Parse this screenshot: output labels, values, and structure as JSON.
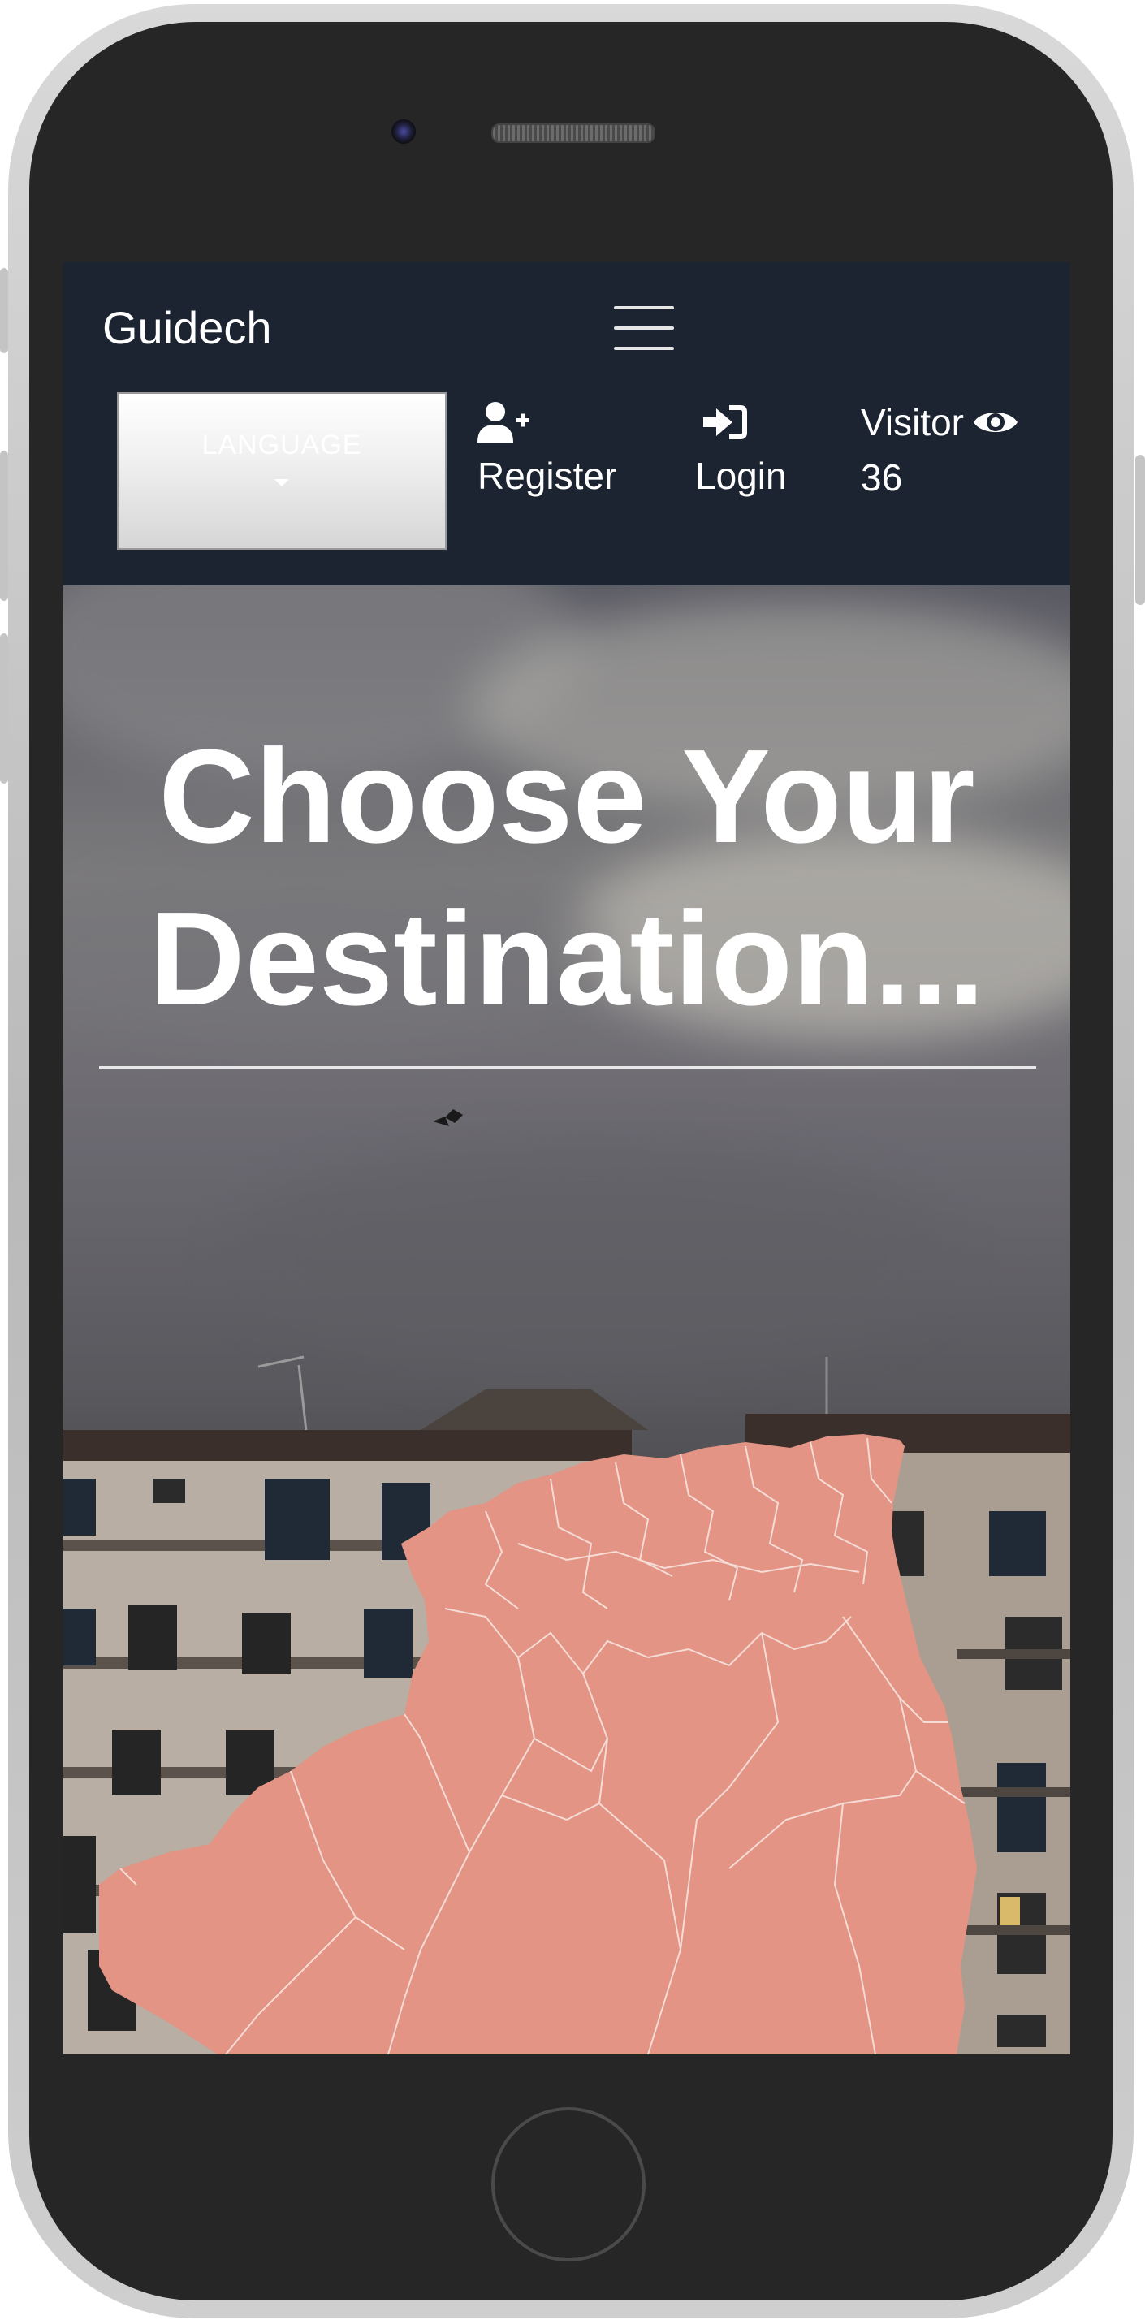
{
  "navbar": {
    "brand": "Guidech",
    "menu_icon": "hamburger-icon",
    "language_label": "LANGUAGE",
    "register": {
      "label": "Register",
      "icon": "user-plus-icon"
    },
    "login": {
      "label": "Login",
      "icon": "sign-in-icon"
    },
    "visitor": {
      "label": "Visitor",
      "icon": "eye-icon",
      "count": "36"
    }
  },
  "hero": {
    "title": "Choose Your Destination..."
  },
  "colors": {
    "navbar_bg": "#1c2331",
    "map_fill": "#e39484",
    "text": "#ffffff"
  }
}
